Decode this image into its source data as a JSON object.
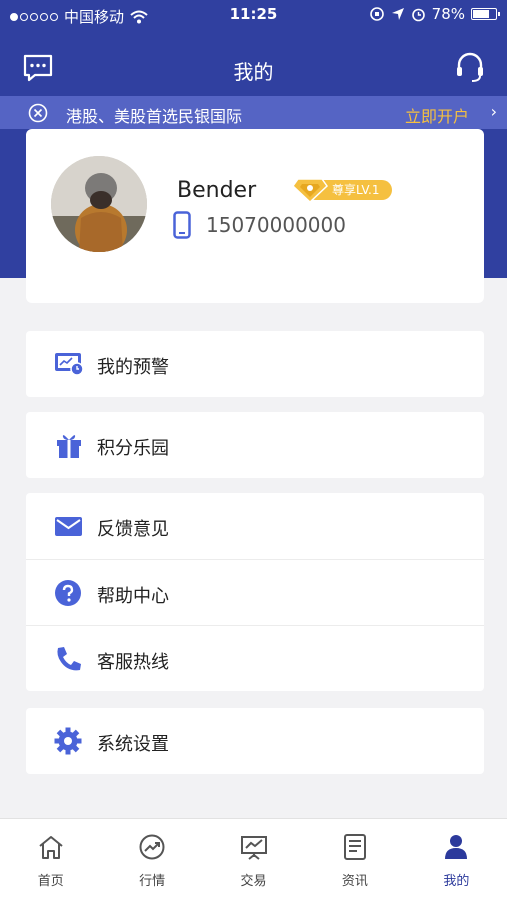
{
  "status_bar": {
    "carrier": "中国移动",
    "time": "11:25",
    "battery": "78%",
    "battery_level": 0.78
  },
  "nav": {
    "title": "我的",
    "left_icon": "message-icon",
    "right_icon": "headset-icon"
  },
  "banner": {
    "text": "港股、美股首选民银国际",
    "cta": "立即开户",
    "chevron": "›"
  },
  "profile": {
    "name": "Bender",
    "vip_label": "尊享LV.1",
    "phone": "15070000000"
  },
  "menu": {
    "alert": "我的预警",
    "points": "积分乐园",
    "feedback": "反馈意见",
    "help": "帮助中心",
    "hotline": "客服热线",
    "settings": "系统设置"
  },
  "tabs": {
    "home": "首页",
    "market": "行情",
    "trade": "交易",
    "news": "资讯",
    "mine": "我的"
  },
  "colors": {
    "primary": "#3040a0",
    "banner": "#5564c4",
    "accent": "#f5c040",
    "icon_blue": "#4a63d8"
  }
}
